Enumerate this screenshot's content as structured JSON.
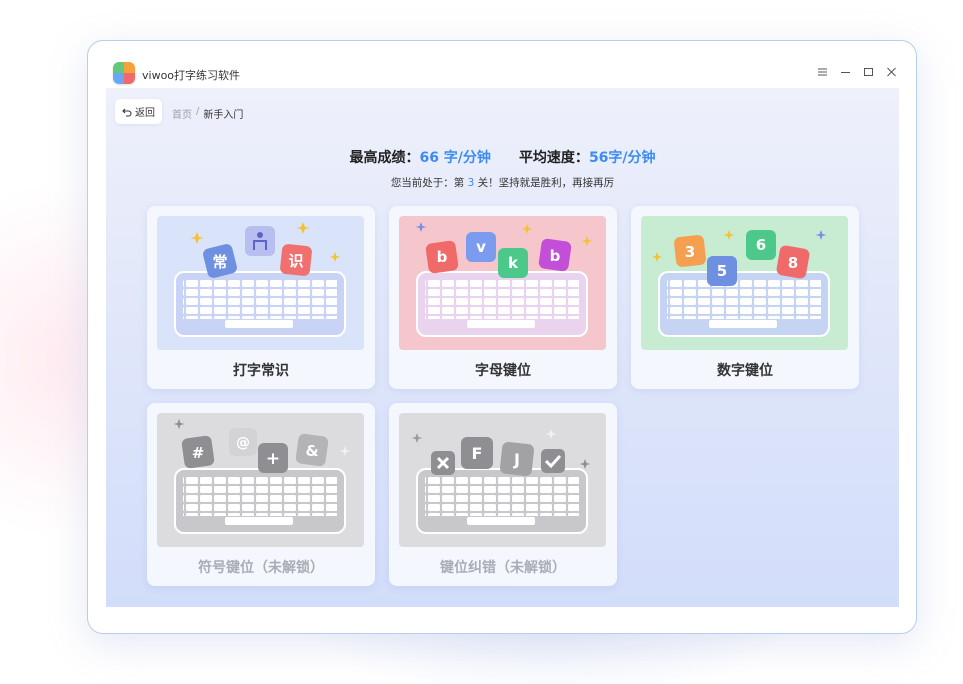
{
  "app": {
    "title": "viwoo打字练习软件"
  },
  "nav": {
    "back_label": "返回"
  },
  "breadcrumb": {
    "home": "首页",
    "separator": "/",
    "current": "新手入门"
  },
  "stats": {
    "best_label": "最高成绩：",
    "best_value": "66 字/分钟",
    "avg_label": "平均速度：",
    "avg_value": "56字/分钟"
  },
  "level": {
    "prefix": "您当前处于：第 ",
    "number": "3",
    "suffix": " 关！坚持就是胜利，再接再厉"
  },
  "cards": [
    {
      "label": "打字常识",
      "locked": false,
      "keys": [
        "常",
        "识"
      ],
      "theme": "#d9e4fb"
    },
    {
      "label": "字母键位",
      "locked": false,
      "keys": [
        "b",
        "v",
        "k",
        "b"
      ],
      "theme": "#f5c7cd"
    },
    {
      "label": "数字键位",
      "locked": false,
      "keys": [
        "3",
        "5",
        "6",
        "8"
      ],
      "theme": "#c8ecd2"
    },
    {
      "label": "符号键位（未解锁）",
      "locked": true,
      "keys": [
        "#",
        "@",
        "+",
        "&"
      ],
      "theme": "#dcdcdf"
    },
    {
      "label": "键位纠错（未解锁）",
      "locked": true,
      "keys": [
        "F",
        "J"
      ],
      "theme": "#dcdcdf"
    }
  ],
  "colors": {
    "accent": "#3d8bf2",
    "border": "#b9cdee"
  },
  "icons": [
    "menu-icon",
    "minimize-icon",
    "maximize-icon",
    "close-icon",
    "back-arrow-icon",
    "sparkle-icon",
    "person-icon",
    "check-icon",
    "cross-icon"
  ]
}
